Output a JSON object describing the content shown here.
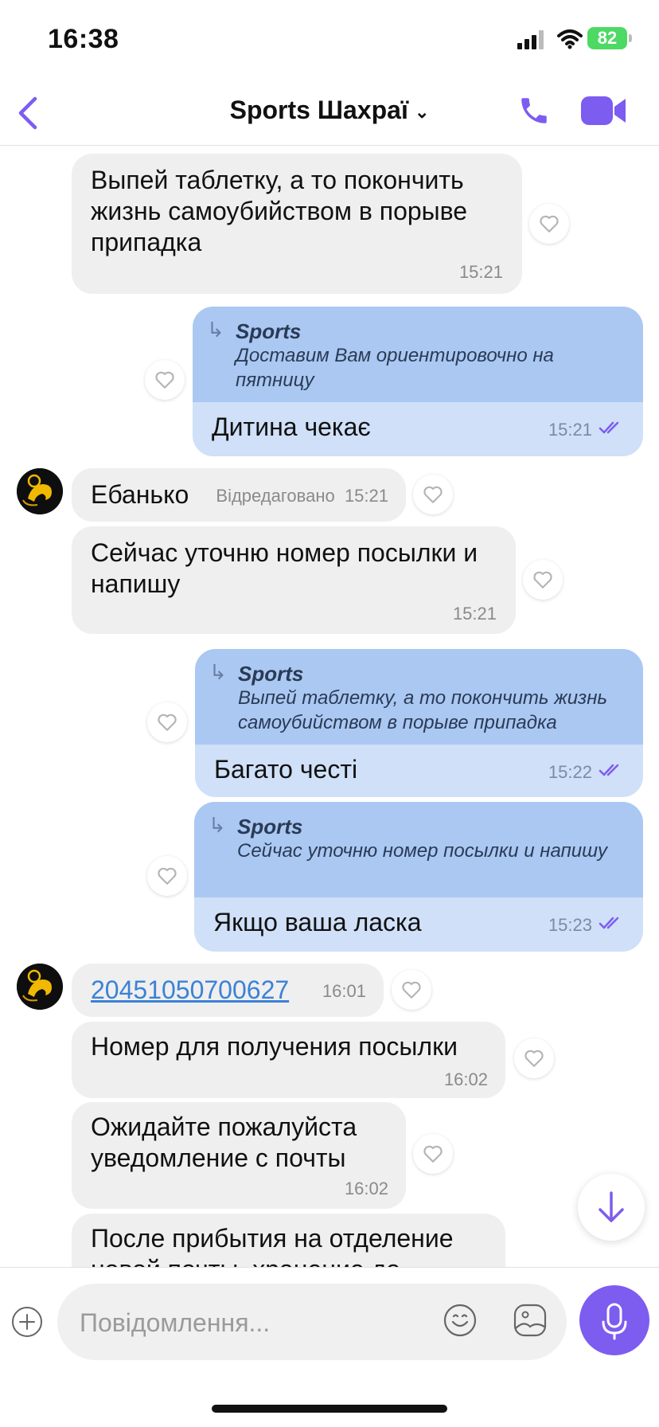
{
  "status_bar": {
    "time": "16:38",
    "battery": "82"
  },
  "header": {
    "title": "Sports Шахраї",
    "dropdown_icon": "chevron-down-icon"
  },
  "colors": {
    "accent": "#7d5cf0",
    "incoming_bubble": "#efefef",
    "outgoing_bubble": "#cfe0f8",
    "quote_bg": "#aac8f2",
    "link": "#3b82d6"
  },
  "messages": [
    {
      "direction": "in",
      "text": "Выпей таблетку, а то покончить жизнь самоубийством в порыве припадка",
      "time": "15:21"
    },
    {
      "direction": "out",
      "quote_author": "Sports",
      "quote_text": "Доставим Вам ориентировочно на пятницу",
      "text": "Дитина чекає",
      "time": "15:21"
    },
    {
      "direction": "in",
      "text": "Ебанько",
      "edited": "Відредаговано",
      "time": "15:21"
    },
    {
      "direction": "in",
      "text": "Сейчас уточню номер посылки и напишу",
      "time": "15:21"
    },
    {
      "direction": "out",
      "quote_author": "Sports",
      "quote_text": "Выпей таблетку, а то покончить жизнь самоубийством в порыве припадка",
      "text": "Багато честі",
      "time": "15:22"
    },
    {
      "direction": "out",
      "quote_author": "Sports",
      "quote_text": "Сейчас уточню номер посылки и напишу",
      "text": "Якщо ваша ласка",
      "time": "15:23"
    },
    {
      "direction": "in",
      "text": "20451050700627",
      "time": "16:01"
    },
    {
      "direction": "in",
      "text": "Номер для получения посылки",
      "time": "16:02"
    },
    {
      "direction": "in",
      "text": "Ожидайте пожалуйста уведомление с почты",
      "time": "16:02"
    },
    {
      "direction": "in",
      "text": "После прибытия на отделение новой почты, хранение до",
      "time": ""
    }
  ],
  "composer": {
    "placeholder": "Повідомлення..."
  }
}
